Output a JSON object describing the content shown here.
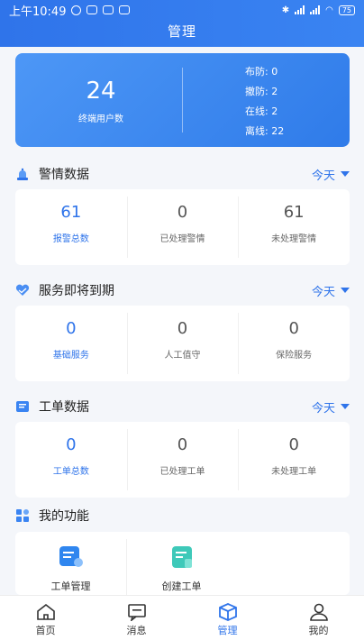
{
  "status_bar": {
    "time": "上午10:49",
    "battery": "75"
  },
  "header": {
    "title": "管理"
  },
  "summary": {
    "terminal_count": "24",
    "terminal_label": "终端用户数",
    "stats": [
      {
        "label": "布防:",
        "value": "0"
      },
      {
        "label": "撤防:",
        "value": "2"
      },
      {
        "label": "在线:",
        "value": "2"
      },
      {
        "label": "离线:",
        "value": "22"
      }
    ]
  },
  "alarm": {
    "title": "警情数据",
    "filter": "今天",
    "items": [
      {
        "value": "61",
        "label": "报警总数"
      },
      {
        "value": "0",
        "label": "已处理警情"
      },
      {
        "value": "61",
        "label": "未处理警情"
      }
    ]
  },
  "service": {
    "title": "服务即将到期",
    "filter": "今天",
    "items": [
      {
        "value": "0",
        "label": "基础服务"
      },
      {
        "value": "0",
        "label": "人工值守"
      },
      {
        "value": "0",
        "label": "保险服务"
      }
    ]
  },
  "workorder": {
    "title": "工单数据",
    "filter": "今天",
    "items": [
      {
        "value": "0",
        "label": "工单总数"
      },
      {
        "value": "0",
        "label": "已处理工单"
      },
      {
        "value": "0",
        "label": "未处理工单"
      }
    ]
  },
  "functions": {
    "title": "我的功能",
    "items": [
      {
        "label": "工单管理",
        "icon": "work-order-manage-icon"
      },
      {
        "label": "创建工单",
        "icon": "create-work-order-icon"
      }
    ]
  },
  "tabbar": {
    "items": [
      {
        "label": "首页",
        "icon": "home-icon"
      },
      {
        "label": "消息",
        "icon": "message-icon"
      },
      {
        "label": "管理",
        "icon": "manage-box-icon"
      },
      {
        "label": "我的",
        "icon": "user-icon"
      }
    ],
    "active": "管理"
  },
  "colors": {
    "primary": "#2f74ea",
    "background": "#f4f6fa"
  }
}
